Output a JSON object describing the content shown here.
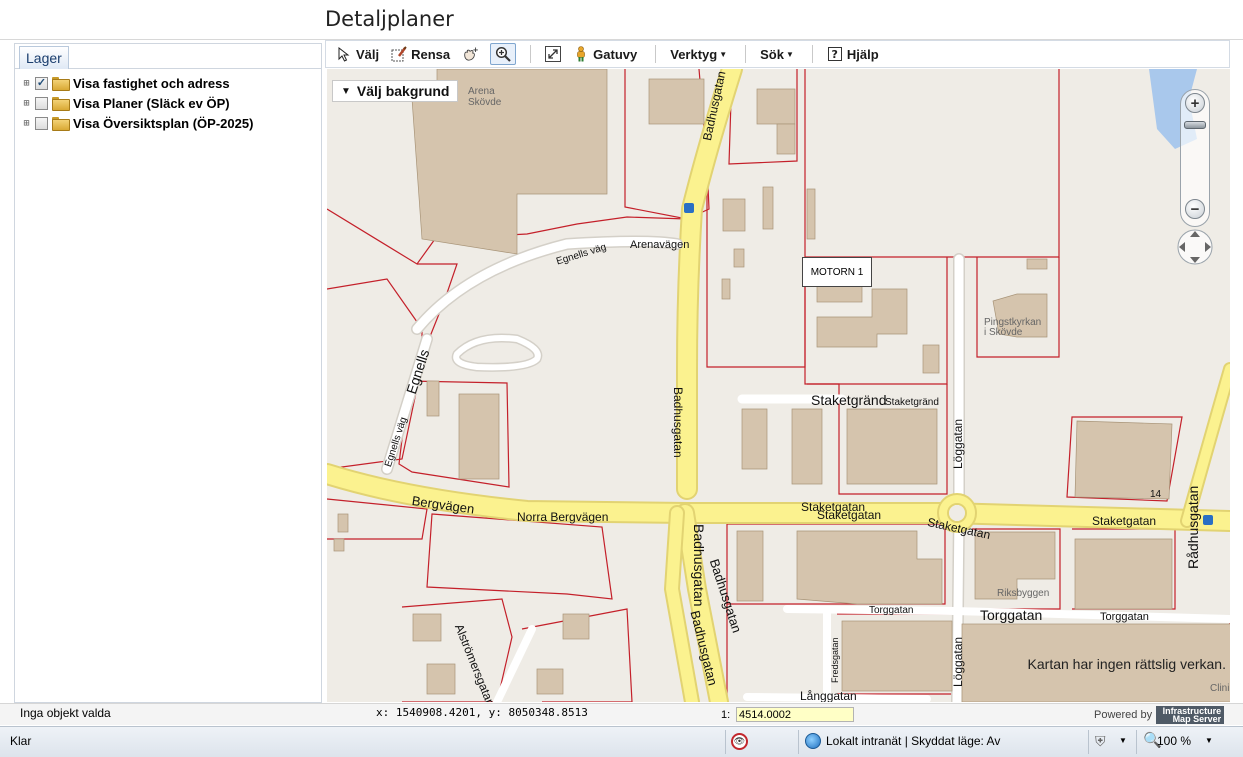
{
  "app": {
    "title": "Detaljplaner"
  },
  "layers": {
    "tab_label": "Lager",
    "items": [
      {
        "label": "Visa fastighet och adress",
        "checked": true,
        "checkmark": "✓"
      },
      {
        "label": "Visa Planer (Släck ev ÖP)",
        "checked": false,
        "checkmark": ""
      },
      {
        "label": "Visa Översiktsplan (ÖP-2025)",
        "checked": false,
        "checkmark": ""
      }
    ]
  },
  "toolbar": {
    "select_label": "Välj",
    "clear_label": "Rensa",
    "streetview_label": "Gatuvy",
    "tools_label": "Verktyg",
    "search_label": "Sök",
    "help_label": "Hjälp",
    "icons": [
      "arrow-cursor-icon",
      "eraser-icon",
      "hand-zoom-icon",
      "magnifier-plus-icon",
      "expand-icon",
      "pegman-icon",
      "question-icon"
    ]
  },
  "map": {
    "background_selector": "Välj bakgrund",
    "object_label": "MOTORN 1",
    "disclaimer": "Kartan har ingen rättslig verkan.",
    "labels": {
      "badhusgatan_north": "Badhusgatan",
      "arena": "Arena\nSkövde",
      "egnells_vag_top": "Egnells väg",
      "arenavagen": "Arenavägen",
      "egnells_diag": "Egnells",
      "egnells_vag_side": "Egnells väg",
      "badhusgatan_mid": "Badhusgatan",
      "staketgrand": "Staketgränd",
      "staketgrand_small": "Staketgränd",
      "loggatan_north": "Löggatan",
      "pingstkyrkan": "Pingstkyrkan\ni Skövde",
      "bergvagen": "Bergvägen",
      "norra_bergvagen": "Norra Bergvägen",
      "staketgatan_1": "Staketgatan",
      "staketgatan_2": "Staketgatan",
      "staketgatan_3": "Staketgatan",
      "staketgatan_east": "Staketgatan",
      "radhusgatan": "Rådhusgatan",
      "badhusgatan_s1": "Badhusgatan",
      "badhusgatan_s2": "Badhusgatan",
      "badhusgatan_s3": "Badhusgatan",
      "torggatan": "Torggatan",
      "torggatan_big": "Torggatan",
      "torggatan_east": "Torggatan",
      "riksbyggen": "Riksbyggen",
      "fredsgatan": "Fredsgatan",
      "loggatan_south": "Löggatan",
      "langgatan": "Långgatan",
      "alstromergatan": "Alströmersgatan",
      "number_14": "14",
      "clinic": "Clini"
    },
    "colors": {
      "road": "#fbf28f",
      "road_edge": "#e2d372",
      "building": "#d5c4ad",
      "building_edge": "#a89478",
      "plan_border": "#c4202a",
      "ground": "#efece6",
      "water": "#a9c8ec"
    }
  },
  "status": {
    "selection": "Inga objekt valda",
    "coordinates": "x: 1540908.4201, y: 8050348.8513",
    "scale_prefix": "1:",
    "scale_value": "4514.0002",
    "powered_by": "Powered by",
    "ims_logo": "Infrastructure Map Server"
  },
  "browser_status": {
    "text": "Klar",
    "zone": "Lokalt intranät | Skyddat läge: Av",
    "zoom": "100 %",
    "icons": [
      "privacy-eye-icon",
      "globe-zone-icon",
      "security-shield-icon",
      "zoom-magnifier-icon"
    ]
  }
}
